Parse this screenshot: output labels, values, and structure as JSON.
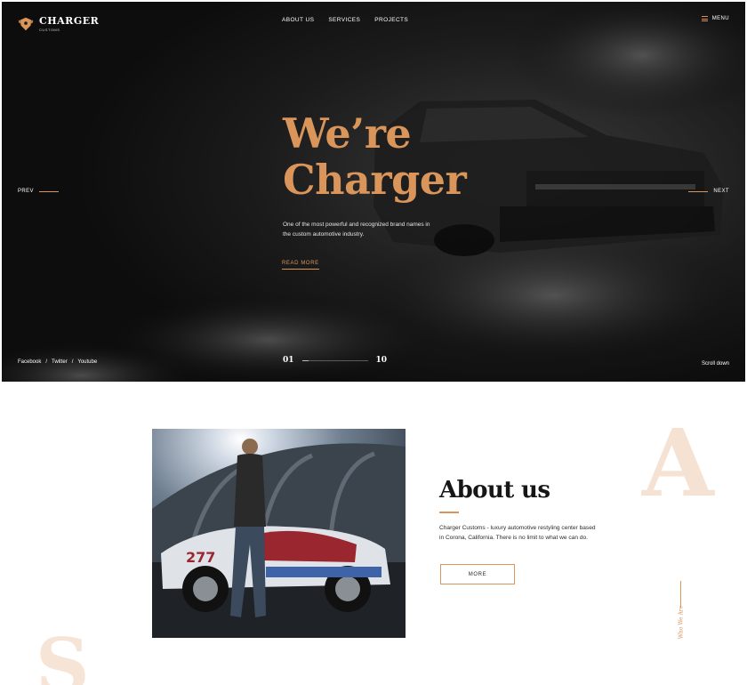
{
  "brand": {
    "name": "CHARGER",
    "sub": "CUSTOMS",
    "accent": "#d9955a"
  },
  "nav": {
    "items": [
      "ABOUT US",
      "SERVICES",
      "PROJECTS"
    ]
  },
  "menu": {
    "label": "MENU",
    "icon": "hamburger-icon"
  },
  "hero": {
    "title_line1": "We’re",
    "title_line2": "Charger",
    "text": "One of the most powerful and recognized brand names in the custom automotive industry.",
    "read_more": "READ MORE",
    "prev": "PREV",
    "next": "NEXT",
    "social": [
      "Facebook",
      "/",
      "Twitter",
      "/",
      "Youtube"
    ],
    "slide_current": "01",
    "slide_total": "10",
    "slide_progress": 0.1,
    "scroll": "Scroll down"
  },
  "about": {
    "title": "About us",
    "text": "Charger Customs - luxury automotive restyling center based in Corona, California. There is no limit to what we can do.",
    "more": "MORE",
    "side_label": "Who We Are",
    "big_letter": "A",
    "next_letter": "S"
  }
}
